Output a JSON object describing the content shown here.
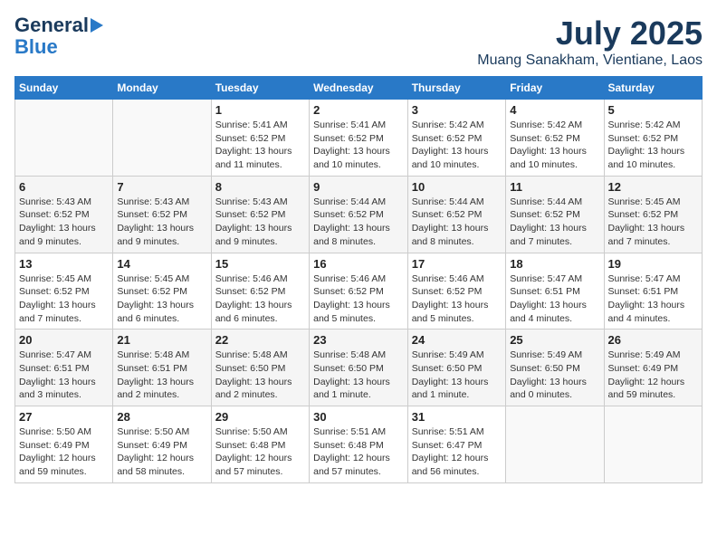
{
  "header": {
    "logo_general": "General",
    "logo_blue": "Blue",
    "month": "July 2025",
    "location": "Muang Sanakham, Vientiane, Laos"
  },
  "weekdays": [
    "Sunday",
    "Monday",
    "Tuesday",
    "Wednesday",
    "Thursday",
    "Friday",
    "Saturday"
  ],
  "weeks": [
    [
      {
        "day": "",
        "info": ""
      },
      {
        "day": "",
        "info": ""
      },
      {
        "day": "1",
        "info": "Sunrise: 5:41 AM\nSunset: 6:52 PM\nDaylight: 13 hours and 11 minutes."
      },
      {
        "day": "2",
        "info": "Sunrise: 5:41 AM\nSunset: 6:52 PM\nDaylight: 13 hours and 10 minutes."
      },
      {
        "day": "3",
        "info": "Sunrise: 5:42 AM\nSunset: 6:52 PM\nDaylight: 13 hours and 10 minutes."
      },
      {
        "day": "4",
        "info": "Sunrise: 5:42 AM\nSunset: 6:52 PM\nDaylight: 13 hours and 10 minutes."
      },
      {
        "day": "5",
        "info": "Sunrise: 5:42 AM\nSunset: 6:52 PM\nDaylight: 13 hours and 10 minutes."
      }
    ],
    [
      {
        "day": "6",
        "info": "Sunrise: 5:43 AM\nSunset: 6:52 PM\nDaylight: 13 hours and 9 minutes."
      },
      {
        "day": "7",
        "info": "Sunrise: 5:43 AM\nSunset: 6:52 PM\nDaylight: 13 hours and 9 minutes."
      },
      {
        "day": "8",
        "info": "Sunrise: 5:43 AM\nSunset: 6:52 PM\nDaylight: 13 hours and 9 minutes."
      },
      {
        "day": "9",
        "info": "Sunrise: 5:44 AM\nSunset: 6:52 PM\nDaylight: 13 hours and 8 minutes."
      },
      {
        "day": "10",
        "info": "Sunrise: 5:44 AM\nSunset: 6:52 PM\nDaylight: 13 hours and 8 minutes."
      },
      {
        "day": "11",
        "info": "Sunrise: 5:44 AM\nSunset: 6:52 PM\nDaylight: 13 hours and 7 minutes."
      },
      {
        "day": "12",
        "info": "Sunrise: 5:45 AM\nSunset: 6:52 PM\nDaylight: 13 hours and 7 minutes."
      }
    ],
    [
      {
        "day": "13",
        "info": "Sunrise: 5:45 AM\nSunset: 6:52 PM\nDaylight: 13 hours and 7 minutes."
      },
      {
        "day": "14",
        "info": "Sunrise: 5:45 AM\nSunset: 6:52 PM\nDaylight: 13 hours and 6 minutes."
      },
      {
        "day": "15",
        "info": "Sunrise: 5:46 AM\nSunset: 6:52 PM\nDaylight: 13 hours and 6 minutes."
      },
      {
        "day": "16",
        "info": "Sunrise: 5:46 AM\nSunset: 6:52 PM\nDaylight: 13 hours and 5 minutes."
      },
      {
        "day": "17",
        "info": "Sunrise: 5:46 AM\nSunset: 6:52 PM\nDaylight: 13 hours and 5 minutes."
      },
      {
        "day": "18",
        "info": "Sunrise: 5:47 AM\nSunset: 6:51 PM\nDaylight: 13 hours and 4 minutes."
      },
      {
        "day": "19",
        "info": "Sunrise: 5:47 AM\nSunset: 6:51 PM\nDaylight: 13 hours and 4 minutes."
      }
    ],
    [
      {
        "day": "20",
        "info": "Sunrise: 5:47 AM\nSunset: 6:51 PM\nDaylight: 13 hours and 3 minutes."
      },
      {
        "day": "21",
        "info": "Sunrise: 5:48 AM\nSunset: 6:51 PM\nDaylight: 13 hours and 2 minutes."
      },
      {
        "day": "22",
        "info": "Sunrise: 5:48 AM\nSunset: 6:50 PM\nDaylight: 13 hours and 2 minutes."
      },
      {
        "day": "23",
        "info": "Sunrise: 5:48 AM\nSunset: 6:50 PM\nDaylight: 13 hours and 1 minute."
      },
      {
        "day": "24",
        "info": "Sunrise: 5:49 AM\nSunset: 6:50 PM\nDaylight: 13 hours and 1 minute."
      },
      {
        "day": "25",
        "info": "Sunrise: 5:49 AM\nSunset: 6:50 PM\nDaylight: 13 hours and 0 minutes."
      },
      {
        "day": "26",
        "info": "Sunrise: 5:49 AM\nSunset: 6:49 PM\nDaylight: 12 hours and 59 minutes."
      }
    ],
    [
      {
        "day": "27",
        "info": "Sunrise: 5:50 AM\nSunset: 6:49 PM\nDaylight: 12 hours and 59 minutes."
      },
      {
        "day": "28",
        "info": "Sunrise: 5:50 AM\nSunset: 6:49 PM\nDaylight: 12 hours and 58 minutes."
      },
      {
        "day": "29",
        "info": "Sunrise: 5:50 AM\nSunset: 6:48 PM\nDaylight: 12 hours and 57 minutes."
      },
      {
        "day": "30",
        "info": "Sunrise: 5:51 AM\nSunset: 6:48 PM\nDaylight: 12 hours and 57 minutes."
      },
      {
        "day": "31",
        "info": "Sunrise: 5:51 AM\nSunset: 6:47 PM\nDaylight: 12 hours and 56 minutes."
      },
      {
        "day": "",
        "info": ""
      },
      {
        "day": "",
        "info": ""
      }
    ]
  ],
  "row_styles": [
    "light",
    "alt",
    "light",
    "alt",
    "light"
  ]
}
